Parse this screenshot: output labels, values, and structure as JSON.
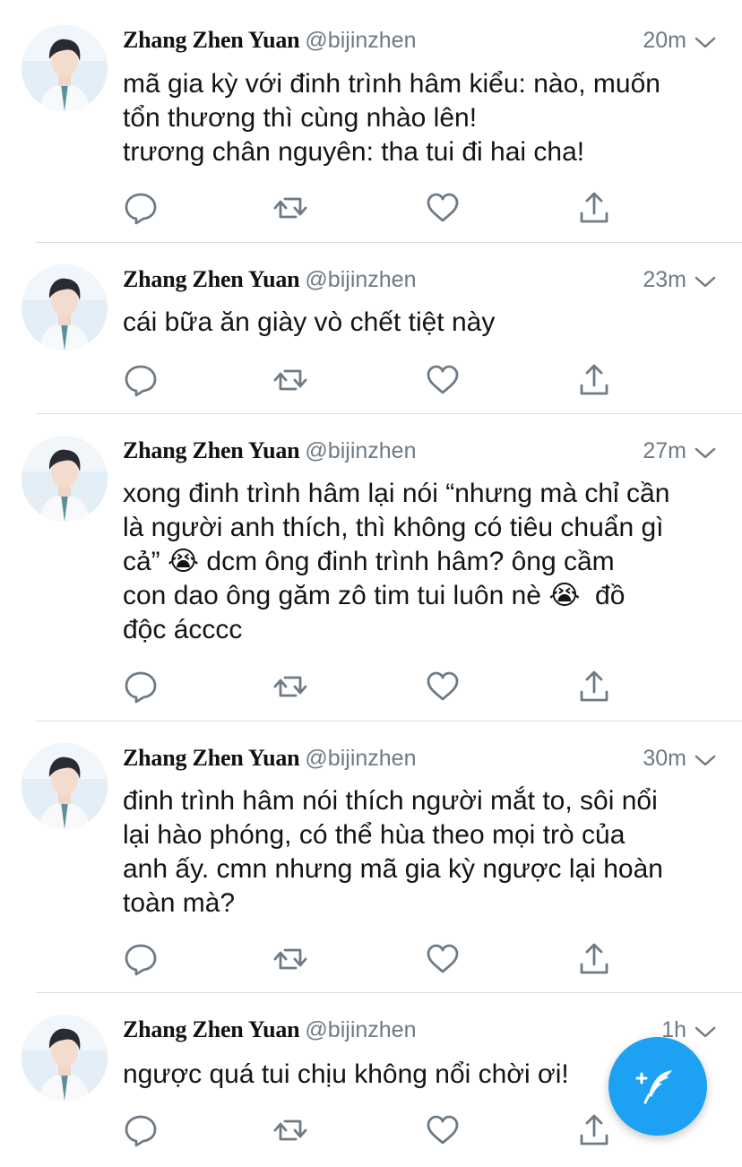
{
  "tweets": [
    {
      "name": "Zhang Zhen Yuan",
      "handle": "@bijinzhen",
      "time": "20m",
      "text": "mã gia kỳ với đinh trình hâm kiểu: nào, muốn\ntổn thương thì cùng nhào lên!\ntrương chân nguyên: tha tui đi hai cha!"
    },
    {
      "name": "Zhang Zhen Yuan",
      "handle": "@bijinzhen",
      "time": "23m",
      "text": "cái bữa ăn giày vò chết tiệt này"
    },
    {
      "name": "Zhang Zhen Yuan",
      "handle": "@bijinzhen",
      "time": "27m",
      "text_parts": [
        "xong đinh trình hâm lại nói “nhưng mà chỉ cần\nlà người anh thích, thì không có tiêu chuẩn gì\ncả” ",
        "😭",
        " dcm ông đinh trình hâm? ông cầm\ncon dao ông găm zô tim tui luôn nè ",
        "😭",
        "  đồ\nđộc ácccc"
      ]
    },
    {
      "name": "Zhang Zhen Yuan",
      "handle": "@bijinzhen",
      "time": "30m",
      "text": "đinh trình hâm nói thích người mắt to, sôi nổi\nlại hào phóng, có thể hùa theo mọi trò của\nanh ấy. cmn nhưng mã gia kỳ ngược lại hoàn\ntoàn mà?"
    },
    {
      "name": "Zhang Zhen Yuan",
      "handle": "@bijinzhen",
      "time": "1h",
      "text": "ngược quá tui chịu không nổi chời ơi!"
    }
  ],
  "icons": {
    "reply": "reply-icon",
    "retweet": "retweet-icon",
    "like": "heart-icon",
    "share": "share-icon",
    "menu": "chevron-down-icon",
    "compose": "compose-tweet-icon"
  },
  "colors": {
    "accent": "#1da1f2",
    "icon_gray": "#6e7a85",
    "text": "#141414",
    "divider": "#d8dde1"
  }
}
